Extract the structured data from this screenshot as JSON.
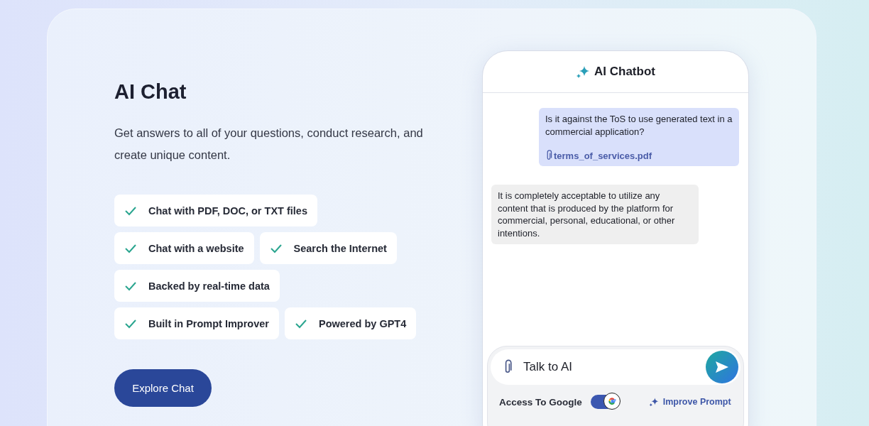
{
  "hero": {
    "title": "AI Chat",
    "description": "Get answers to all of your questions, conduct research, and create unique content.",
    "feature_rows": [
      [
        {
          "label": "Chat with PDF, DOC, or TXT files"
        }
      ],
      [
        {
          "label": "Chat with a website"
        },
        {
          "label": "Search the Internet"
        }
      ],
      [
        {
          "label": "Backed by real-time data"
        }
      ],
      [
        {
          "label": "Built in Prompt Improver"
        },
        {
          "label": "Powered by GPT4"
        }
      ]
    ],
    "button": "Explore Chat"
  },
  "chatbot": {
    "title": "AI Chatbot",
    "messages": [
      {
        "kind": "user",
        "text": "Is it against the ToS to use generated text in a commercial application?",
        "attachment": "terms_of_services.pdf"
      },
      {
        "kind": "bot",
        "text": "It is completely acceptable to utilize any content that is produced by the platform for commercial, personal, educational, or other intentions."
      }
    ],
    "input": {
      "value": "Talk to AI"
    },
    "google_access": {
      "label": "Access To Google",
      "on": true
    },
    "improve_prompt": "Improve Prompt"
  }
}
